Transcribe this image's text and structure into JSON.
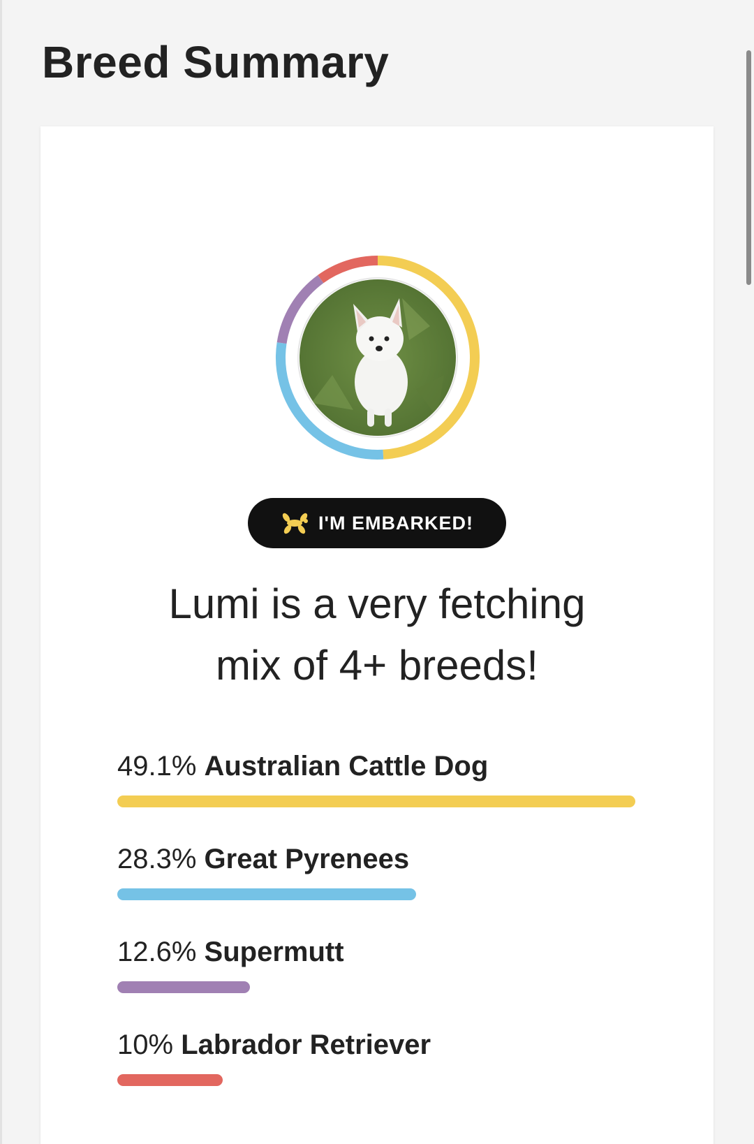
{
  "page": {
    "title": "Breed Summary"
  },
  "profile": {
    "photo_subject": "white puppy sitting on grass",
    "badge_icon": "balloon-dog-icon",
    "badge_label": "I'M EMBARKED!",
    "headline_line1": "Lumi is a very fetching",
    "headline_line2": "mix of 4+ breeds!"
  },
  "chart_data": {
    "type": "bar",
    "categories": [
      "Australian Cattle Dog",
      "Great Pyrenees",
      "Supermutt",
      "Labrador Retriever"
    ],
    "values": [
      49.1,
      28.3,
      12.6,
      10
    ],
    "labels": [
      "49.1%",
      "28.3%",
      "12.6%",
      "10%"
    ],
    "colors": [
      "#f3cd53",
      "#75c2e6",
      "#a080b3",
      "#e2675f"
    ]
  },
  "colors": {
    "background": "#f4f4f4",
    "card": "#ffffff",
    "badge": "#111111",
    "badge_icon": "#f3cd53"
  }
}
